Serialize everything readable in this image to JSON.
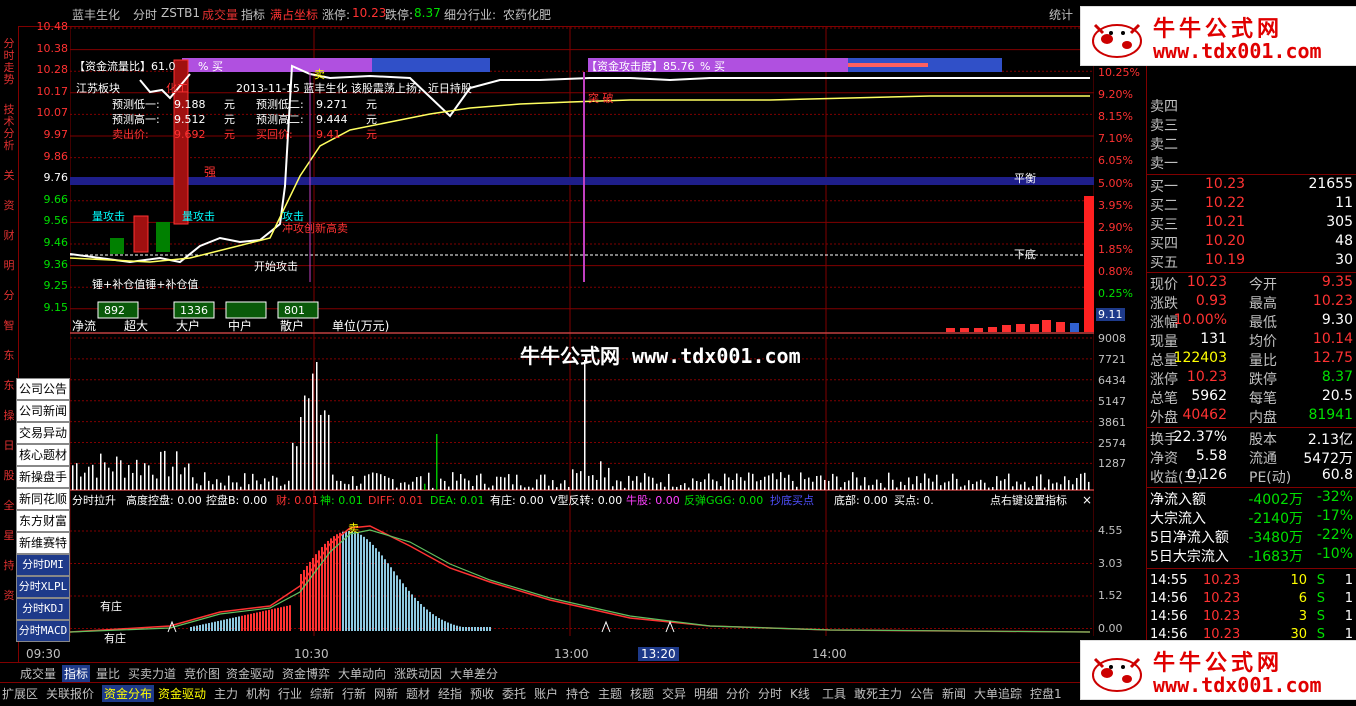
{
  "topbar": {
    "stock_name": "蓝丰生化",
    "mode": "分时",
    "indicator_name": "ZSTB1",
    "volume_label": "成交量",
    "indicator_label": "指标",
    "coord_label": "满占坐标",
    "limit_up_label": "涨停:",
    "limit_up_value": "10.23",
    "limit_down_label": "跌停:",
    "limit_down_value": "8.37",
    "industry_label": "细分行业:",
    "industry_value": "农药化肥",
    "stats_label": "统计"
  },
  "leftnav": [
    "分时走势",
    "技术分析",
    "关",
    "资",
    "财",
    "明",
    "分",
    "智",
    "东",
    "东",
    "操",
    "日",
    "股",
    "全",
    "星",
    "持",
    "资"
  ],
  "price_axis_left": [
    "10.48",
    "10.38",
    "10.28",
    "10.17",
    "10.07",
    "9.97",
    "9.86",
    "9.76",
    "9.66",
    "9.56",
    "9.46",
    "9.36",
    "9.25",
    "9.15"
  ],
  "pct_axis_right": [
    "10.25%",
    "9.20%",
    "8.15%",
    "7.10%",
    "6.05%",
    "5.00%",
    "3.95%",
    "2.90%",
    "1.85%",
    "0.80%",
    "0.25%"
  ],
  "current_tag": "9.11",
  "volume_axis": [
    "9008",
    "7721",
    "6434",
    "5147",
    "3861",
    "2574",
    "1287"
  ],
  "indicator_axis": [
    "4.55",
    "3.03",
    "1.52",
    "0.00"
  ],
  "overlay": {
    "fund_flow_ratio": "【资金流量比】61.0",
    "buy_label": "% 买",
    "fund_attack": "【资金攻击度】85.76",
    "buy_label2": "% 买",
    "sector": "江苏板块",
    "sector_sub": "化工",
    "news": "2013-11-15 蓝丰生化 该股震荡上扬，近日持股",
    "pred_low1_label": "预测低一:",
    "pred_low1": "9.188",
    "pred_low2_label": "预测低二:",
    "pred_low2": "9.271",
    "pred_high1_label": "预测高一:",
    "pred_high1": "9.512",
    "pred_high2_label": "预测高二:",
    "pred_high2": "9.444",
    "sell_label": "卖出价:",
    "sell": "9.692",
    "buyback_label": "买回价:",
    "buyback": "9.41",
    "unit": "元",
    "qiang": "强",
    "balance": "平衡",
    "bottom": "下底",
    "vol_attack1": "量攻击",
    "vol_attack2": "量攻击",
    "vol_attack3": "攻击",
    "attack_start": "开始攻击",
    "hammer": "锤+补仓值锤+补仓值",
    "sell_mark": "卖",
    "rush": "冲攻创新高卖",
    "breakthrough": "突  破"
  },
  "flow_boxes": {
    "values": [
      "892",
      "1336",
      "",
      "801"
    ],
    "labels": [
      "净流",
      "超大",
      "大户",
      "中户",
      "散户"
    ],
    "unit": "单位(万元)"
  },
  "indicator_bar": {
    "title": "分时拉升",
    "height_ctrl": "高度控盘: 0.00",
    "ctrl_b": "控盘B: 0.00",
    "cai": "财: 0.01",
    "shen": "神: 0.01",
    "diff": "DIFF: 0.01",
    "dea": "DEA: 0.01",
    "youzhuang": "有庄: 0.00",
    "vfan": "V型反转: 0.00",
    "niugu": "牛股: 0.00",
    "fantan": "反弹GGG: 0.00",
    "chaodie": "抄底买点",
    "dibu": "底部: 0.00",
    "maidian": "买点: 0.",
    "right_hint": "点右键设置指标",
    "youzhuang_mark": "有庄",
    "youzhuang_mark2": "有庄",
    "sell_mark": "卖"
  },
  "left_menu": [
    "公司公告",
    "公司新闻",
    "交易异动",
    "核心题材",
    "新操盘手",
    "新同花顺",
    "东方财富",
    "新维赛特",
    "分时DMI",
    "分时XLPL",
    "分时KDJ",
    "分时MACD"
  ],
  "time_axis": [
    "09:30",
    "10:30",
    "13:00",
    "13:20",
    "14:00"
  ],
  "quote": {
    "asks": [
      {
        "label": "卖四",
        "price": "",
        "vol": ""
      },
      {
        "label": "卖三",
        "price": "",
        "vol": ""
      },
      {
        "label": "卖二",
        "price": "",
        "vol": ""
      },
      {
        "label": "卖一",
        "price": "",
        "vol": ""
      }
    ],
    "bids": [
      {
        "label": "买一",
        "price": "10.23",
        "vol": "21655"
      },
      {
        "label": "买二",
        "price": "10.22",
        "vol": "11"
      },
      {
        "label": "买三",
        "price": "10.21",
        "vol": "305"
      },
      {
        "label": "买四",
        "price": "10.20",
        "vol": "48"
      },
      {
        "label": "买五",
        "price": "10.19",
        "vol": "30"
      }
    ],
    "stats": [
      {
        "l1": "现价",
        "v1": "10.23",
        "c1": "red",
        "l2": "今开",
        "v2": "9.35",
        "c2": "red"
      },
      {
        "l1": "涨跌",
        "v1": "0.93",
        "c1": "red",
        "l2": "最高",
        "v2": "10.23",
        "c2": "red"
      },
      {
        "l1": "涨幅",
        "v1": "10.00%",
        "c1": "red",
        "l2": "最低",
        "v2": "9.30",
        "c2": "white"
      },
      {
        "l1": "现量",
        "v1": "131",
        "c1": "white",
        "l2": "均价",
        "v2": "10.14",
        "c2": "red"
      },
      {
        "l1": "总量",
        "v1": "122403",
        "c1": "yellow",
        "l2": "量比",
        "v2": "12.75",
        "c2": "red"
      },
      {
        "l1": "涨停",
        "v1": "10.23",
        "c1": "red",
        "l2": "跌停",
        "v2": "8.37",
        "c2": "green"
      },
      {
        "l1": "总笔",
        "v1": "5962",
        "c1": "white",
        "l2": "每笔",
        "v2": "20.5",
        "c2": "white"
      },
      {
        "l1": "外盘",
        "v1": "40462",
        "c1": "red",
        "l2": "内盘",
        "v2": "81941",
        "c2": "green"
      }
    ],
    "stats2": [
      {
        "l1": "换手",
        "v1": "22.37%",
        "c1": "white",
        "l2": "股本",
        "v2": "2.13亿",
        "c2": "white"
      },
      {
        "l1": "净资",
        "v1": "5.58",
        "c1": "white",
        "l2": "流通",
        "v2": "5472万",
        "c2": "white"
      },
      {
        "l1": "收益(三)",
        "v1": "0.126",
        "c1": "white",
        "l2": "PE(动)",
        "v2": "60.8",
        "c2": "white"
      }
    ],
    "flows": [
      {
        "label": "净流入额",
        "amount": "-4002万",
        "pct": "-32%"
      },
      {
        "label": "大宗流入",
        "amount": "-2140万",
        "pct": "-17%"
      },
      {
        "label": "5日净流入额",
        "amount": "-3480万",
        "pct": "-22%"
      },
      {
        "label": "5日大宗流入",
        "amount": "-1683万",
        "pct": "-10%"
      }
    ],
    "ticks": [
      {
        "time": "14:55",
        "price": "10.23",
        "vol": "10",
        "side": "S",
        "n": "1"
      },
      {
        "time": "14:56",
        "price": "10.23",
        "vol": "6",
        "side": "S",
        "n": "1"
      },
      {
        "time": "14:56",
        "price": "10.23",
        "vol": "3",
        "side": "S",
        "n": "1"
      },
      {
        "time": "14:56",
        "price": "10.23",
        "vol": "30",
        "side": "S",
        "n": "1"
      },
      {
        "time": "14:56",
        "price": "10.23",
        "vol": "5",
        "side": "S",
        "n": "1"
      },
      {
        "time": "14:56",
        "price": "10.23",
        "vol": "",
        "side": "",
        "n": ""
      }
    ]
  },
  "tabs1": [
    "成交量",
    "指标",
    "量比",
    "买卖力道",
    "竞价图",
    "资金驱动",
    "资金博弈",
    "大单动向",
    "涨跌动因",
    "大单差分"
  ],
  "tabs2": [
    "扩展区",
    "关联报价",
    "资金分布",
    "资金驱动",
    "主力",
    "机构",
    "行业",
    "综新",
    "行新",
    "网新",
    "题材",
    "经指",
    "预收",
    "委托",
    "账户",
    "持仓",
    "主题",
    "核题",
    "交异",
    "明细",
    "分价",
    "分时",
    "K线",
    "工具",
    "敢死主力",
    "公告",
    "新闻",
    "大单追踪",
    "控盘1"
  ],
  "watermark": {
    "title": "牛牛公式网",
    "url": "www.tdx001.com",
    "center": "牛牛公式网 www.tdx001.com"
  },
  "colors": {
    "grid": "#800000",
    "price_line": "#ffffff",
    "avg_line": "#ffff00",
    "up": "#ff3232",
    "down": "#00e000"
  }
}
